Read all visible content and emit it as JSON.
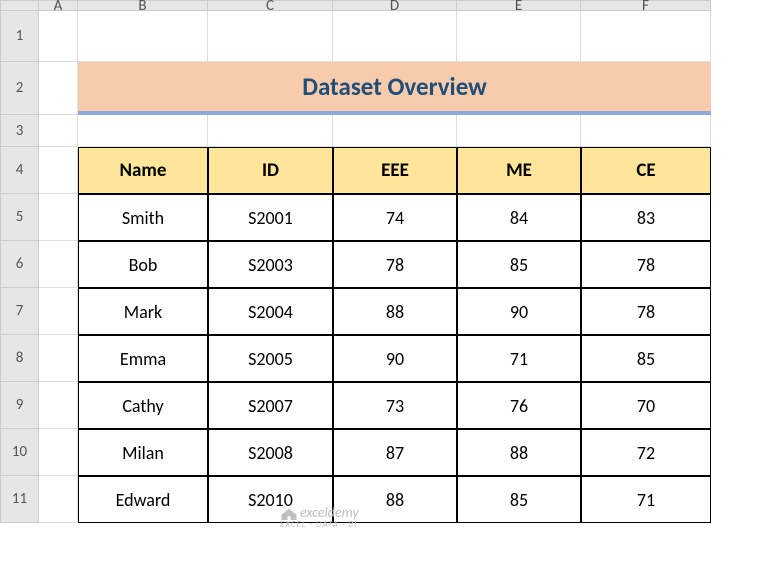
{
  "col_headers": [
    "A",
    "B",
    "C",
    "D",
    "E",
    "F"
  ],
  "row_headers": [
    "1",
    "2",
    "3",
    "4",
    "5",
    "6",
    "7",
    "8",
    "9",
    "10",
    "11"
  ],
  "title": "Dataset Overview",
  "table": {
    "headers": [
      "Name",
      "ID",
      "EEE",
      "ME",
      "CE"
    ],
    "rows": [
      [
        "Smith",
        "S2001",
        "74",
        "84",
        "83"
      ],
      [
        "Bob",
        "S2003",
        "78",
        "85",
        "78"
      ],
      [
        "Mark",
        "S2004",
        "88",
        "90",
        "78"
      ],
      [
        "Emma",
        "S2005",
        "90",
        "71",
        "85"
      ],
      [
        "Cathy",
        "S2007",
        "73",
        "76",
        "70"
      ],
      [
        "Milan",
        "S2008",
        "87",
        "88",
        "72"
      ],
      [
        "Edward",
        "S2010",
        "88",
        "85",
        "71"
      ]
    ]
  },
  "watermark": {
    "brand": "exceldemy",
    "sub": "EXCEL · DATA · BI"
  },
  "chart_data": {
    "type": "table",
    "title": "Dataset Overview",
    "columns": [
      "Name",
      "ID",
      "EEE",
      "ME",
      "CE"
    ],
    "rows": [
      {
        "Name": "Smith",
        "ID": "S2001",
        "EEE": 74,
        "ME": 84,
        "CE": 83
      },
      {
        "Name": "Bob",
        "ID": "S2003",
        "EEE": 78,
        "ME": 85,
        "CE": 78
      },
      {
        "Name": "Mark",
        "ID": "S2004",
        "EEE": 88,
        "ME": 90,
        "CE": 78
      },
      {
        "Name": "Emma",
        "ID": "S2005",
        "EEE": 90,
        "ME": 71,
        "CE": 85
      },
      {
        "Name": "Cathy",
        "ID": "S2007",
        "EEE": 73,
        "ME": 76,
        "CE": 70
      },
      {
        "Name": "Milan",
        "ID": "S2008",
        "EEE": 87,
        "ME": 88,
        "CE": 72
      },
      {
        "Name": "Edward",
        "ID": "S2010",
        "EEE": 88,
        "ME": 85,
        "CE": 71
      }
    ]
  }
}
